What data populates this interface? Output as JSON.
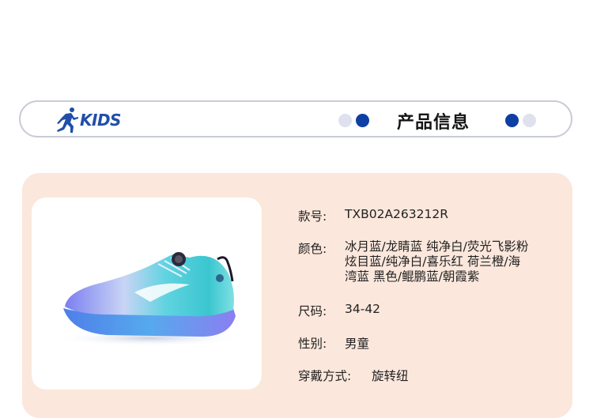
{
  "header": {
    "brand": "KIDS",
    "title": "产品信息"
  },
  "product": {
    "image_alt": "blue gradient running shoe",
    "specs": {
      "article_label": "款号:",
      "article_value": "TXB02A263212R",
      "color_label": "颜色:",
      "color_lines": [
        "冰月蓝/龙睛蓝 纯净白/荧光飞影粉",
        "炫目蓝/纯净白/喜乐红 荷兰橙/海",
        "湾蓝 黑色/鲲鹏蓝/朝霞紫"
      ],
      "size_label": "尺码:",
      "size_value": "34-42",
      "gender_label": "性别:",
      "gender_value": "男童",
      "fastening_label": "穿戴方式:",
      "fastening_value": "旋转纽"
    }
  },
  "colors": {
    "brand_blue": "#1f4fa8",
    "dot_dark": "#0e3fa2",
    "dot_light": "#dfe2ee",
    "card_bg": "#fbe7dc"
  }
}
